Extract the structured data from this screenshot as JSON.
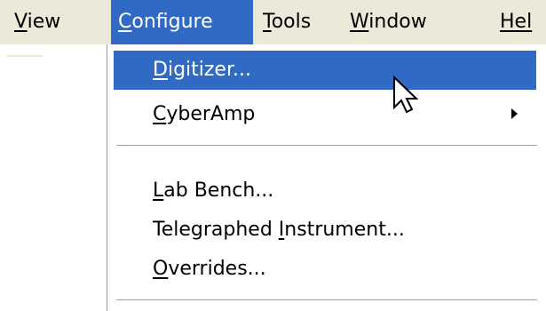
{
  "menubar": {
    "items": [
      {
        "underline": "V",
        "rest": "iew",
        "open": false
      },
      {
        "underline": "C",
        "rest": "onfigure",
        "open": true
      },
      {
        "underline": "T",
        "rest": "ools",
        "open": false
      },
      {
        "underline": "W",
        "rest": "indow",
        "open": false
      },
      {
        "underline": "Hel",
        "rest": "",
        "open": false
      }
    ]
  },
  "dropdown": {
    "items": [
      {
        "pre": "",
        "underline": "D",
        "post": "igitizer...",
        "highlighted": true,
        "submenu": false
      },
      {
        "pre": "",
        "underline": "C",
        "post": "yberAmp",
        "highlighted": false,
        "submenu": true
      },
      {
        "pre": "",
        "underline": "L",
        "post": "ab Bench...",
        "highlighted": false,
        "submenu": false
      },
      {
        "pre": "Telegraphed ",
        "underline": "I",
        "post": "nstrument...",
        "highlighted": false,
        "submenu": false
      },
      {
        "pre": "",
        "underline": "O",
        "post": "verrides...",
        "highlighted": false,
        "submenu": false
      }
    ]
  },
  "colors": {
    "highlight": "#316ac5",
    "menubar_bg": "#ece9d8"
  },
  "cursor": {
    "icon": "arrow-cursor-icon"
  }
}
